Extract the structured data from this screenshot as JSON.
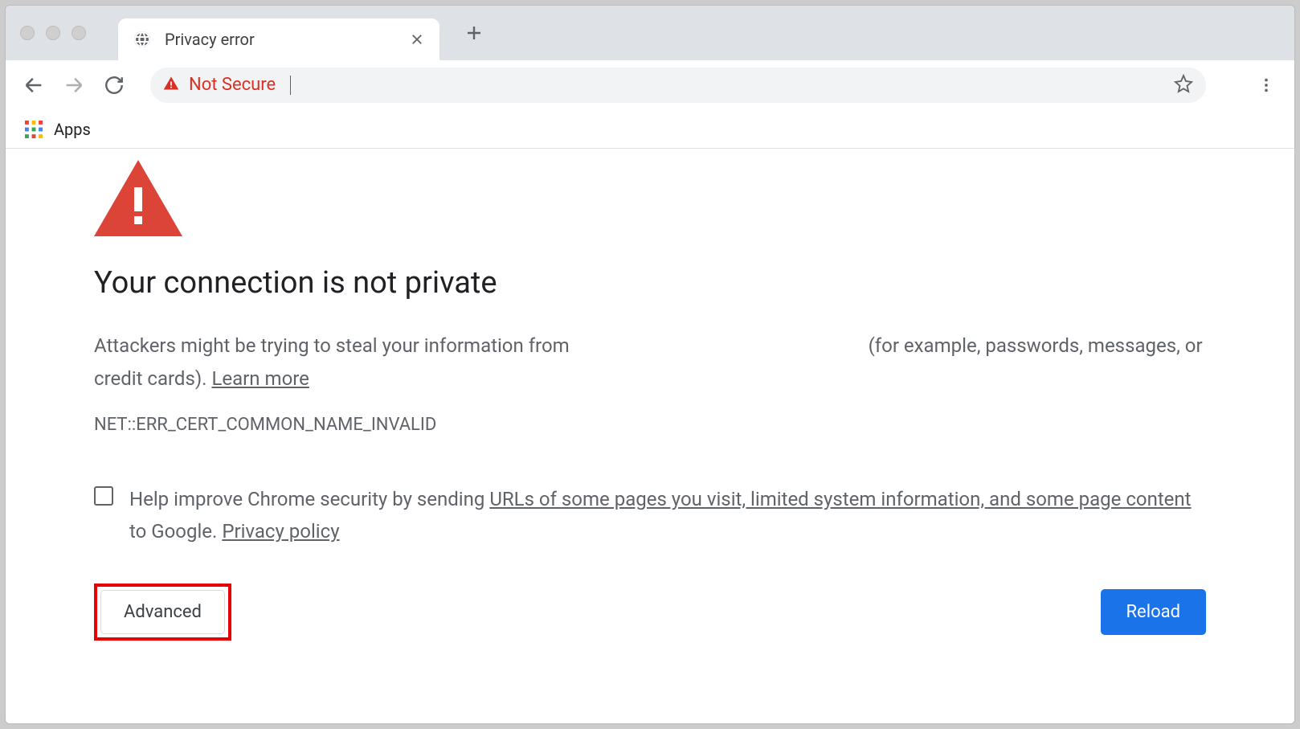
{
  "tab": {
    "title": "Privacy error"
  },
  "omnibox": {
    "secure_label": "Not Secure"
  },
  "bookmarks": {
    "apps_label": "Apps"
  },
  "page": {
    "heading": "Your connection is not private",
    "body_prefix": "Attackers might be trying to steal your information from ",
    "body_middle": " (for example, passwords, messages, or credit cards). ",
    "learn_more": "Learn more",
    "error_code": "NET::ERR_CERT_COMMON_NAME_INVALID",
    "optin_prefix": "Help improve Chrome security by sending ",
    "optin_link1": "URLs of some pages you visit, limited system information, and some page content",
    "optin_mid": " to Google. ",
    "optin_link2": "Privacy policy",
    "advanced_label": "Advanced",
    "reload_label": "Reload"
  }
}
